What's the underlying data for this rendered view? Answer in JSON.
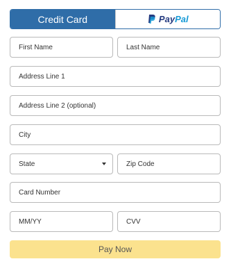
{
  "tabs": {
    "credit_card": "Credit Card",
    "paypal_pay": "Pay",
    "paypal_pal": "Pal"
  },
  "fields": {
    "first_name": "First Name",
    "last_name": "Last Name",
    "address1": "Address Line 1",
    "address2": "Address Line 2 (optional)",
    "city": "City",
    "state": "State",
    "zip": "Zip Code",
    "card_number": "Card Number",
    "expiry": "MM/YY",
    "cvv": "CVV"
  },
  "submit": {
    "label": "Pay Now"
  },
  "colors": {
    "accent": "#2f6da8",
    "submit": "#fbe28e",
    "paypal_dark": "#253b80",
    "paypal_light": "#179bd7"
  },
  "icons": {
    "paypal": "paypal-logo-icon",
    "state_dropdown": "chevron-down-icon"
  }
}
